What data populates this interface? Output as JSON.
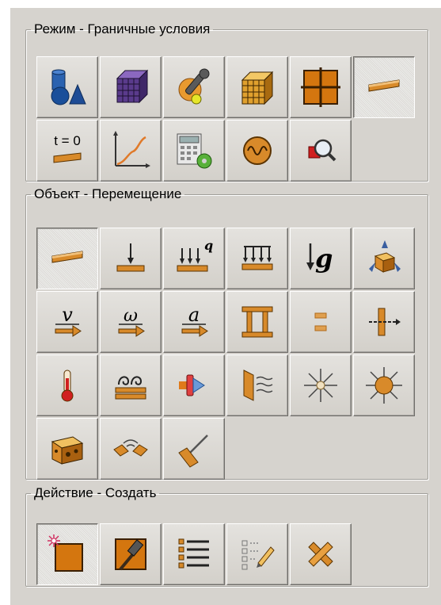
{
  "groups": {
    "mode": {
      "legend": "Режим - Граничные условия"
    },
    "object": {
      "legend": "Объект - Перемещение"
    },
    "action": {
      "legend": "Действие - Создать"
    }
  },
  "mode_buttons": {
    "time_zero_label": "t = 0"
  },
  "object_buttons": {
    "load_q_label": "q",
    "gravity_label": "g",
    "velocity_label": "v",
    "angular_velocity_label": "ω",
    "acceleration_label": "a"
  },
  "state": {
    "mode_selected": "boundary-conditions-button",
    "object_selected": "displacement-button",
    "action_selected": "create-button"
  },
  "colors": {
    "orange": "#d88a2a",
    "orange_dark": "#8a4f12",
    "blue": "#1f4f8f",
    "purple": "#5a3b8c"
  }
}
